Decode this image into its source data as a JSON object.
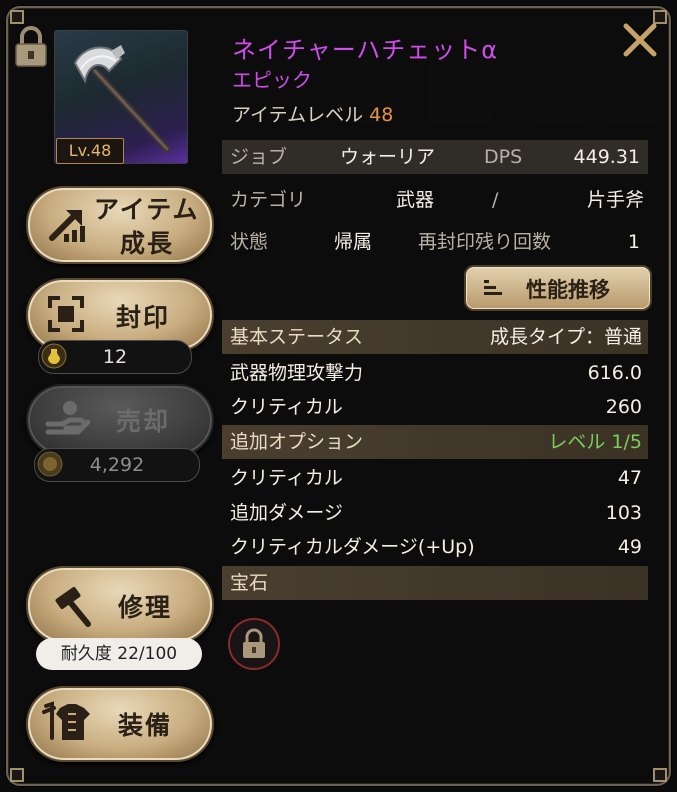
{
  "item": {
    "name": "ネイチャーハチェットα",
    "rarity": "エピック",
    "item_level_label": "アイテムレベル",
    "item_level_value": "48",
    "thumb_level": "Lv.48"
  },
  "info_rows": {
    "job_label": "ジョブ",
    "job_value": "ウォーリア",
    "dps_label": "DPS",
    "dps_value": "449.31",
    "category_label": "カテゴリ",
    "category_value1": "武器",
    "category_sep": "/",
    "category_value2": "片手斧",
    "state_label": "状態",
    "state_value": "帰属",
    "reseal_label": "再封印残り回数",
    "reseal_value": "1"
  },
  "perf_button": "性能推移",
  "basic_status": {
    "header": "基本ステータス",
    "growth_type": "成長タイプ：普通",
    "rows": [
      {
        "label": "武器物理攻撃力",
        "value": "616.0"
      },
      {
        "label": "クリティカル",
        "value": "260"
      }
    ]
  },
  "additional_options": {
    "header": "追加オプション",
    "level": "レベル 1/5",
    "rows": [
      {
        "label": "クリティカル",
        "value": "47"
      },
      {
        "label": "追加ダメージ",
        "value": "103"
      },
      {
        "label": "クリティカルダメージ(+Up)",
        "value": "49"
      }
    ]
  },
  "gem": {
    "header": "宝石"
  },
  "side_buttons": {
    "grow_line1": "アイテム",
    "grow_line2": "成長",
    "seal": "封印",
    "seal_count": "12",
    "sell": "売却",
    "sell_price": "4,292",
    "repair": "修理",
    "durability": "耐久度 22/100",
    "equip": "装備"
  },
  "colors": {
    "epic_purple": "#cf4dea",
    "level_orange": "#e7923e",
    "option_green": "#78d05a"
  },
  "icons": [
    "lock-icon",
    "close-icon",
    "grow-arrow-icon",
    "seal-frame-icon",
    "potion-icon",
    "sell-hand-icon",
    "coin-icon",
    "hammer-icon",
    "armor-icon",
    "chart-icon"
  ]
}
